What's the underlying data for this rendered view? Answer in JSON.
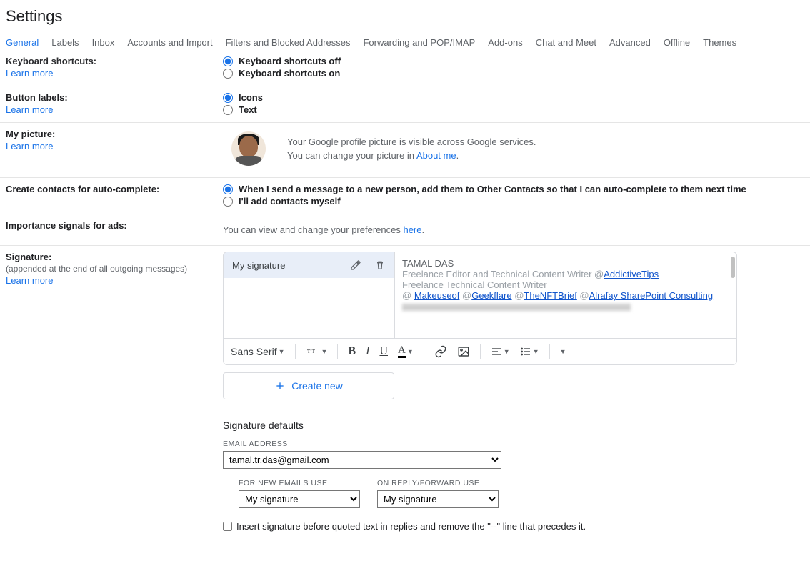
{
  "page_title": "Settings",
  "tabs": [
    "General",
    "Labels",
    "Inbox",
    "Accounts and Import",
    "Filters and Blocked Addresses",
    "Forwarding and POP/IMAP",
    "Add-ons",
    "Chat and Meet",
    "Advanced",
    "Offline",
    "Themes"
  ],
  "active_tab": "General",
  "keyboard_shortcuts": {
    "title": "Keyboard shortcuts:",
    "learn_more": "Learn more",
    "opt_off": "Keyboard shortcuts off",
    "opt_on": "Keyboard shortcuts on"
  },
  "button_labels": {
    "title": "Button labels:",
    "learn_more": "Learn more",
    "opt_icons": "Icons",
    "opt_text": "Text"
  },
  "my_picture": {
    "title": "My picture:",
    "learn_more": "Learn more",
    "line1": "Your Google profile picture is visible across Google services.",
    "line2_pre": "You can change your picture in ",
    "about_me": "About me",
    "line2_post": "."
  },
  "auto_complete": {
    "title": "Create contacts for auto-complete:",
    "opt1": "When I send a message to a new person, add them to Other Contacts so that I can auto-complete to them next time",
    "opt2": "I'll add contacts myself"
  },
  "ads": {
    "title": "Importance signals for ads:",
    "text_pre": "You can view and change your preferences ",
    "here": "here",
    "text_post": "."
  },
  "signature": {
    "title": "Signature:",
    "subtitle": "(appended at the end of all outgoing messages)",
    "learn_more": "Learn more",
    "item_name": "My signature",
    "content": {
      "name": "TAMAL DAS",
      "role1_pre": "Freelance Editor and Technical Content Writer @",
      "link1": "AddictiveTips",
      "role2": "Freelance Technical Content Writer",
      "at": "@ ",
      "link_muo": "Makeuseof",
      "at2": " @",
      "link_geek": "Geekflare",
      "at3": " @",
      "link_nft": "TheNFTBrief",
      "at4": " @",
      "link_al": "Alrafay SharePoint Consulting"
    },
    "font": "Sans Serif",
    "create_new": "Create new",
    "defaults_title": "Signature defaults",
    "email_label": "EMAIL ADDRESS",
    "email_value": "tamal.tr.das@gmail.com",
    "for_new_label": "FOR NEW EMAILS USE",
    "on_reply_label": "ON REPLY/FORWARD USE",
    "sig_option": "My signature",
    "insert_checkbox": "Insert signature before quoted text in replies and remove the \"--\" line that precedes it."
  }
}
